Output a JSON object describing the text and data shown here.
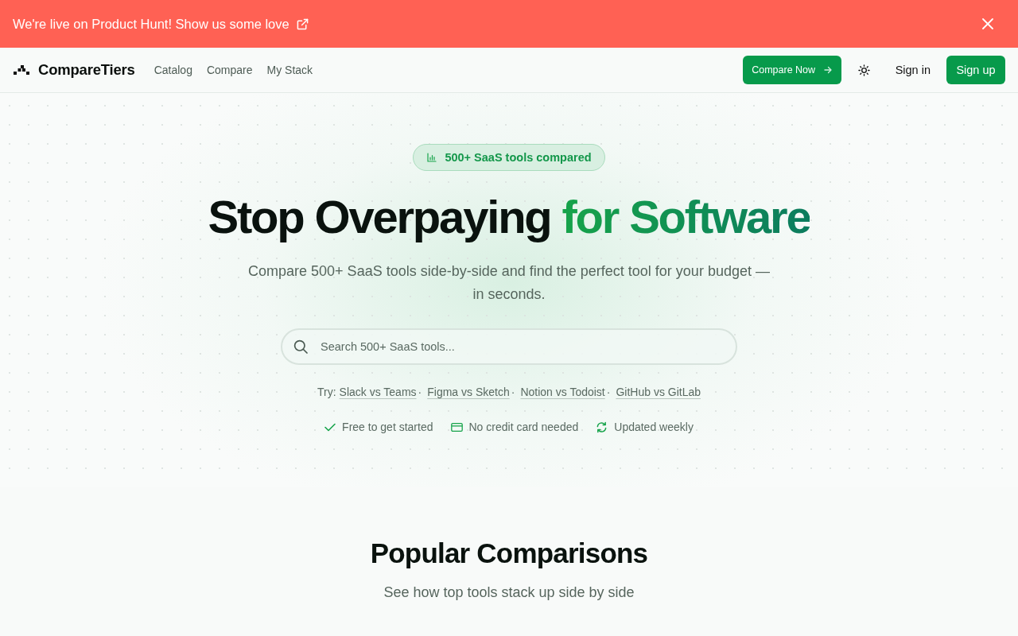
{
  "banner": {
    "text": "We're live on Product Hunt! Show us some love"
  },
  "nav": {
    "brand": "CompareTiers",
    "links": [
      {
        "label": "Catalog"
      },
      {
        "label": "Compare"
      },
      {
        "label": "My Stack"
      }
    ],
    "cta": "Compare Now",
    "sign_in": "Sign in",
    "sign_up": "Sign up"
  },
  "hero": {
    "badge": "500+ SaaS tools compared",
    "title": "Stop Overpaying",
    "title_highlight": "for Software",
    "subtitle": "Compare 500+ SaaS tools side-by-side and find the perfect tool for your budget — in seconds.",
    "search": {
      "placeholder": "Search 500+ SaaS tools..."
    },
    "try_label": "Try:",
    "separator": "·",
    "suggestions": [
      {
        "label": "Slack vs Teams"
      },
      {
        "label": "Figma vs Sketch"
      },
      {
        "label": "Notion vs Todoist"
      },
      {
        "label": "GitHub vs GitLab"
      }
    ],
    "features": [
      {
        "kind": "check",
        "text": "Free to get started"
      },
      {
        "kind": "card",
        "text": "No credit card needed"
      },
      {
        "kind": "refresh",
        "text": "Updated weekly"
      }
    ]
  },
  "popular": {
    "title": "Popular Comparisons",
    "subtitle": "See how top tools stack up side by side"
  }
}
